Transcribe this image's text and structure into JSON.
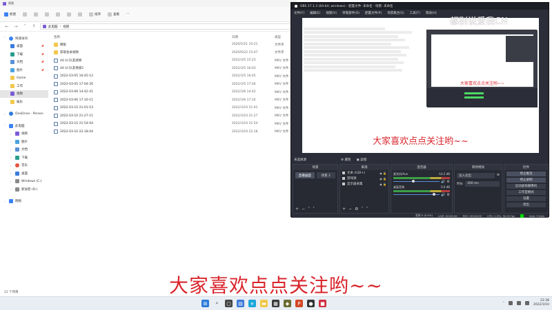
{
  "explorer": {
    "title": "视频",
    "toolbar": [
      {
        "label": "新建",
        "icon": "new-icon"
      },
      {
        "label": "排序",
        "icon": "sort-icon"
      },
      {
        "label": "查看",
        "icon": "view-icon"
      }
    ],
    "address": {
      "parts": [
        "此电脑",
        "视频"
      ]
    },
    "nav": [
      {
        "label": "快速访问",
        "icon": "star",
        "indent": false,
        "caret": "˅"
      },
      {
        "label": "桌面",
        "icon": "desk",
        "indent": true,
        "pin": true
      },
      {
        "label": "下载",
        "icon": "down",
        "indent": true,
        "pin": true
      },
      {
        "label": "文档",
        "icon": "doc",
        "indent": true,
        "pin": true
      },
      {
        "label": "图片",
        "icon": "pic",
        "indent": true,
        "pin": true
      },
      {
        "label": "Gome",
        "icon": "folder",
        "indent": true
      },
      {
        "label": "工作",
        "icon": "folder",
        "indent": true
      },
      {
        "label": "视频",
        "icon": "video",
        "indent": true,
        "selected": true
      },
      {
        "label": "娱乐",
        "icon": "folder",
        "indent": true
      },
      {
        "gap": true
      },
      {
        "label": "OneDrive - Person",
        "icon": "cloud",
        "indent": false,
        "caret": "›"
      },
      {
        "gap": true
      },
      {
        "label": "此电脑",
        "icon": "pc",
        "indent": false,
        "caret": "˅"
      },
      {
        "label": "视频",
        "icon": "video",
        "indent": true,
        "caret": "›"
      },
      {
        "label": "图片",
        "icon": "pic",
        "indent": true,
        "caret": "›"
      },
      {
        "label": "文档",
        "icon": "doc",
        "indent": true,
        "caret": "›"
      },
      {
        "label": "下载",
        "icon": "down",
        "indent": true,
        "caret": "›"
      },
      {
        "label": "音乐",
        "icon": "music",
        "indent": true,
        "caret": "›"
      },
      {
        "label": "桌面",
        "icon": "desk",
        "indent": true,
        "caret": "›"
      },
      {
        "label": "Windows (C:)",
        "icon": "drive",
        "indent": true,
        "caret": "›"
      },
      {
        "label": "新加卷 (D:)",
        "icon": "drive",
        "indent": true,
        "caret": "›"
      },
      {
        "gap": true
      },
      {
        "label": "网络",
        "icon": "net",
        "indent": false,
        "caret": "›"
      }
    ],
    "columns": {
      "name": "名称",
      "date": "日期",
      "type": "类型"
    },
    "files": [
      {
        "name": "模板",
        "date": "2020/5/21 10:21",
        "type": "文件夹",
        "kind": "folder"
      },
      {
        "name": "获取会录视频",
        "date": "2020/6/22 15:47",
        "type": "文件夹",
        "kind": "folder"
      },
      {
        "name": "44   UI 队友感情",
        "date": "2022/3/5 15:23",
        "type": "MKV 文件",
        "kind": "mkv"
      },
      {
        "name": "44   UI 队友情感2",
        "date": "2022/3/5 16:03",
        "type": "MKV 文件",
        "kind": "mkv"
      },
      {
        "name": "2022-03-05 16-45-12",
        "date": "2022/3/5 16:45",
        "type": "MKV 文件",
        "kind": "mkv"
      },
      {
        "name": "2022-03-05 17-04-26",
        "date": "2022/3/5 17:04",
        "type": "MKV 文件",
        "kind": "mkv"
      },
      {
        "name": "2022-03-06 14-42-41",
        "date": "2022/3/6 14:42",
        "type": "MKV 文件",
        "kind": "mkv"
      },
      {
        "name": "2022-03-06 17-10-11",
        "date": "2022/3/6 17:10",
        "type": "MKV 文件",
        "kind": "mkv"
      },
      {
        "name": "2022-03-10 21-01-53",
        "date": "2022/3/10 21:01",
        "type": "MKV 文件",
        "kind": "mkv"
      },
      {
        "name": "2022-03-10 21-27-11",
        "date": "2022/3/10 21:27",
        "type": "MKV 文件",
        "kind": "mkv"
      },
      {
        "name": "2022-03-10 21-54-04",
        "date": "2022/3/10 21:54",
        "type": "MKV 文件",
        "kind": "mkv"
      },
      {
        "name": "2022-03-10 22-18-04",
        "date": "2022/3/10 22:18",
        "type": "MKV 文件",
        "kind": "mkv"
      }
    ],
    "status": "12 个项目"
  },
  "obs": {
    "title": "OBS 27.1.3 (64-bit, windows) - 配置文件: 未命名 - 场景: 未命名",
    "menu": [
      "文件(F)",
      "编辑(E)",
      "视图(V)",
      "停靠部件(D)",
      "配置文件(P)",
      "场景集合(S)",
      "工具(T)",
      "帮助(H)"
    ],
    "preview_subtitle": "大家喜欢点点关注哟~~",
    "nested_subtitle": "大家喜欢点点关注哟~~",
    "scene_label": "未选择源",
    "props_label": "属性",
    "filters_label": "滤镜",
    "docks": {
      "scenes": {
        "title": "场景",
        "items": [
          "直播画面",
          "场景 2"
        ]
      },
      "sources": {
        "title": "来源",
        "items": [
          "文本 (GDI+)",
          "游戏源",
          "显示器采集"
        ]
      },
      "mixer": {
        "title": "混音器",
        "channels": [
          {
            "name": "麦克风/Aux",
            "db": "-14.2 dB"
          },
          {
            "name": "桌面音频",
            "db": "0.0 dB"
          }
        ]
      },
      "transitions": {
        "title": "转场特效",
        "type": "淡入淡出",
        "duration_label": "时长",
        "duration": "300 ms"
      },
      "controls": {
        "title": "控件",
        "buttons": [
          "停止推流",
          "停止录制",
          "启动虚拟摄像机",
          "工作室模式",
          "设置",
          "退出"
        ]
      }
    },
    "status": {
      "dropped": "丢帧 0 (0.0%)",
      "live": "LIVE: 00:00:00",
      "rec": "REC: 00:00:00",
      "cpu": "CPU: 1.9%, 30.00 fps",
      "rate": "kb/s: 0 kb/s"
    }
  },
  "desktop": {
    "watermark": "都别说爱我CN",
    "subtitle": "大家喜欢点点关注哟~~"
  },
  "taskbar": {
    "time": "22:38",
    "date": "2022/3/10"
  }
}
